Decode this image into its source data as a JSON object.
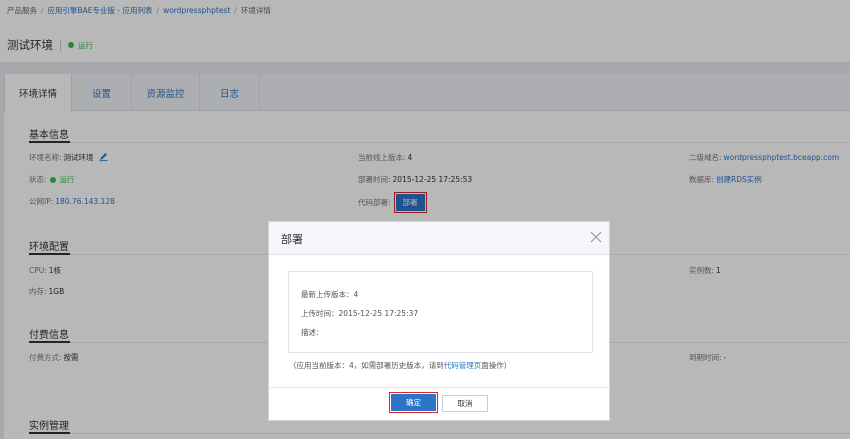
{
  "breadcrumb": {
    "items": [
      "产品服务",
      "应用引擎BAE专业版 - 应用列表",
      "wordpressphptest",
      "环境详情"
    ],
    "separator": "/"
  },
  "header": {
    "title": "测试环境",
    "status": "运行"
  },
  "tabs": [
    {
      "label": "环境详情",
      "active": true
    },
    {
      "label": "设置",
      "active": false
    },
    {
      "label": "资源监控",
      "active": false
    },
    {
      "label": "日志",
      "active": false
    }
  ],
  "basic": {
    "title": "基本信息",
    "env_name_label": "环境名称:",
    "env_name_value": "测试环境",
    "status_label": "状态:",
    "status_value": "运行",
    "ip_label": "公网IP:",
    "ip_value": "180.76.143.128",
    "online_ver_label": "当前线上版本:",
    "online_ver_value": "4",
    "deploy_time_label": "部署时间:",
    "deploy_time_value": "2015-12-25 17:25:53",
    "code_deploy_label": "代码部署:",
    "deploy_button": "部署",
    "domain_label": "二级域名:",
    "domain_value": "wordpressphptest.bceapp.com",
    "db_label": "数据库:",
    "db_value": "创建RDS实例"
  },
  "env_config": {
    "title": "环境配置",
    "cpu_label": "CPU:",
    "cpu_value": "1核",
    "mem_label": "内存:",
    "mem_value": "1GB",
    "instances_label": "实例数:",
    "instances_value": "1"
  },
  "billing": {
    "title": "付费信息",
    "method_label": "付费方式:",
    "method_value": "按需",
    "expire_label": "到期时间:",
    "expire_value": "-"
  },
  "instances": {
    "title": "实例管理"
  },
  "modal": {
    "title": "部署",
    "latest_version": "最新上传版本：4",
    "upload_time": "上传时间：2015-12-25 17:25:37",
    "description": "描述：",
    "hint_prefix": "（应用当前版本：4，如需部署历史版本，请到",
    "hint_link": "代码管理页",
    "hint_suffix": "面操作）",
    "confirm": "确定",
    "cancel": "取消"
  },
  "colors": {
    "accent": "#2b74c7",
    "running": "#3cbb4b",
    "highlight": "#d9262c"
  }
}
